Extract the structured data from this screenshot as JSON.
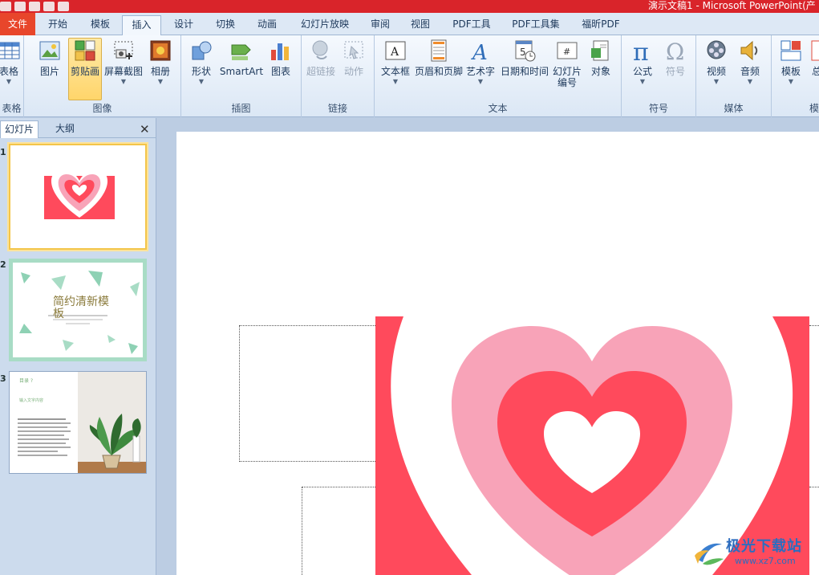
{
  "window": {
    "title": "演示文稿1 - Microsoft PowerPoint(产"
  },
  "tabs": [
    "文件",
    "开始",
    "模板",
    "插入",
    "设计",
    "切换",
    "动画",
    "幻灯片放映",
    "审阅",
    "视图",
    "PDF工具",
    "PDF工具集",
    "福昕PDF"
  ],
  "active_tab": "插入",
  "ribbon": {
    "groups": {
      "table": "表格",
      "images": "图像",
      "illustrations": "插图",
      "links": "链接",
      "text": "文本",
      "symbols": "符号",
      "media": "媒体",
      "template": "模"
    },
    "buttons": {
      "table": "表格",
      "picture": "图片",
      "clipart": "剪贴画",
      "screenshot": "屏幕截图",
      "album": "相册",
      "shapes": "形状",
      "smartart": "SmartArt",
      "chart": "图表",
      "hyperlink": "超链接",
      "action": "动作",
      "textbox": "文本框",
      "header_footer": "页眉和页脚",
      "wordart": "艺术字",
      "datetime": "日期和时间",
      "slide_number_1": "幻灯片",
      "slide_number_2": "编号",
      "object": "对象",
      "equation": "公式",
      "symbol": "符号",
      "video": "视频",
      "audio": "音频",
      "template": "模板",
      "overall": "总"
    }
  },
  "panel": {
    "tab_slides": "幻灯片",
    "tab_outline": "大纲",
    "close": "✕",
    "slides": [
      {
        "num": "1"
      },
      {
        "num": "2",
        "title": "简约清新模",
        "title2": "板"
      },
      {
        "num": "3",
        "title": "目录 ?",
        "sub": "输入文字内容"
      }
    ]
  },
  "watermark": {
    "text": "极光下载站",
    "url": "www.xz7.com"
  },
  "colors": {
    "accent": "#e8462b",
    "titlebar": "#d9242a",
    "heart_red": "#ff4a5c",
    "heart_pink": "#f8a3b8"
  }
}
